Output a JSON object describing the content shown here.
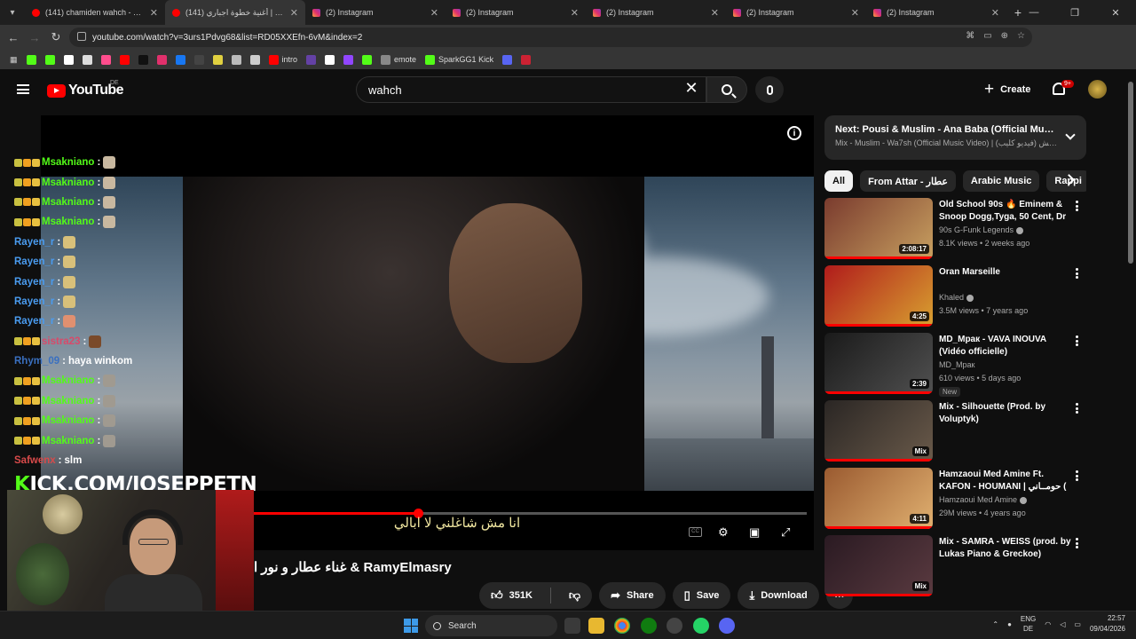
{
  "browser": {
    "tabs": [
      {
        "title": "(141) chamiden wahch - YouTube",
        "favicon": "youtube-icon",
        "active": false
      },
      {
        "title": "(141) أغنية خطوة اجباري | gbary",
        "favicon": "youtube-icon",
        "active": true
      },
      {
        "title": "(2) Instagram",
        "favicon": "instagram-icon",
        "active": false
      },
      {
        "title": "(2) Instagram",
        "favicon": "instagram-icon",
        "active": false
      },
      {
        "title": "(2) Instagram",
        "favicon": "instagram-icon",
        "active": false
      },
      {
        "title": "(2) Instagram",
        "favicon": "instagram-icon",
        "active": false
      },
      {
        "title": "(2) Instagram",
        "favicon": "instagram-icon",
        "active": false
      }
    ],
    "url": "youtube.com/watch?v=3urs1Pdvg68&list=RD05XXEfn-6vM&index=2",
    "bookmarks": [
      {
        "label": "",
        "color": "#53fc18"
      },
      {
        "label": "",
        "color": "#53fc18"
      },
      {
        "label": "",
        "color": "#ffffff"
      },
      {
        "label": "",
        "color": "#dddddd"
      },
      {
        "label": "",
        "color": "#ff4d8d"
      },
      {
        "label": "",
        "color": "#ff0000"
      },
      {
        "label": "",
        "color": "#111111"
      },
      {
        "label": "",
        "color": "#e1306c"
      },
      {
        "label": "",
        "color": "#1877f2"
      },
      {
        "label": "",
        "color": "#444444"
      },
      {
        "label": "",
        "color": "#e0d040"
      },
      {
        "label": "",
        "color": "#bbbbbb"
      },
      {
        "label": "",
        "color": "#cccccc"
      },
      {
        "label": "intro",
        "color": "#ff0000"
      },
      {
        "label": "",
        "color": "#6441a5"
      },
      {
        "label": "",
        "color": "#ffffff"
      },
      {
        "label": "",
        "color": "#9146ff"
      },
      {
        "label": "",
        "color": "#53fc18"
      },
      {
        "label": "emote",
        "color": "#888888"
      },
      {
        "label": "SparkGG1 Kick",
        "color": "#53fc18"
      },
      {
        "label": "",
        "color": "#5865f2"
      },
      {
        "label": "",
        "color": "#cc2233"
      }
    ]
  },
  "youtube": {
    "logo_text": "YouTube",
    "region": "DE",
    "search_value": "wahch",
    "create_label": "Create",
    "notification_badge": "9+",
    "video_title": "غناء عطار و نور ا & RamyElmasry",
    "lyrics": "انا مش شاغلني لا ابالي",
    "progress_fraction": 0.493,
    "actions": {
      "likes": "351K",
      "share": "Share",
      "save": "Save",
      "download": "Download"
    },
    "next": {
      "title": "Next: Pousi & Muslim - Ana Baba (Official Music Vi...",
      "subtitle": "Mix - Muslim - Wa7sh (Official Music Video) | وحش (فيديو كليب)..."
    },
    "chips": [
      "All",
      "From Attar - عطار",
      "Arabic Music",
      "Rappi"
    ],
    "recommendations": [
      {
        "title": "Old School 90s 🔥 Eminem & Snoop Dogg,Tyga, 50 Cent, Dr ...",
        "channel": "90s G-Funk Legends",
        "verified": true,
        "meta": "8.1K views • 2 weeks ago",
        "duration": "2:08:17",
        "new": false,
        "thumb_colors": [
          "#7a3b2e",
          "#c8a060"
        ]
      },
      {
        "title": "Oran Marseille",
        "channel": "Khaled",
        "verified": true,
        "meta": "3.5M views • 7 years ago",
        "duration": "4:25",
        "new": false,
        "thumb_colors": [
          "#b01b1b",
          "#d8a030"
        ]
      },
      {
        "title": "MD_Мрак - VAVA INOUVA (Vidéo officielle)",
        "channel": "MD_Мрак",
        "verified": false,
        "meta": "610 views • 5 days ago",
        "duration": "2:39",
        "new": true,
        "new_label": "New",
        "thumb_colors": [
          "#1a1a1a",
          "#505050"
        ]
      },
      {
        "title": "Mix - Silhouette (Prod. by Voluptyk)",
        "channel": "",
        "verified": false,
        "meta": "",
        "duration": "Mix",
        "new": false,
        "thumb_colors": [
          "#2a2624",
          "#6a5a4a"
        ]
      },
      {
        "title": "Hamzaoui Med Amine Ft. KAFON - HOUMANI | حومــاني ( ...",
        "channel": "Hamzaoui Med Amine",
        "verified": true,
        "meta": "29M views • 4 years ago",
        "duration": "4:11",
        "new": false,
        "thumb_colors": [
          "#9a5a30",
          "#e0b070"
        ]
      },
      {
        "title": "Mix - SAMRA - WEISS (prod. by Lukas Piano & Greckoe)",
        "channel": "",
        "verified": false,
        "meta": "",
        "duration": "Mix",
        "new": false,
        "thumb_colors": [
          "#2a1a22",
          "#5a3a40"
        ]
      }
    ]
  },
  "chat": [
    {
      "user": "Msakniano",
      "color": "#53fc18",
      "msg": "",
      "badges": true,
      "emote": "#c8b8a0"
    },
    {
      "user": "Msakniano",
      "color": "#53fc18",
      "msg": "",
      "badges": true,
      "emote": "#c8b8a0"
    },
    {
      "user": "Msakniano",
      "color": "#53fc18",
      "msg": "",
      "badges": true,
      "emote": "#c8b8a0"
    },
    {
      "user": "Msakniano",
      "color": "#53fc18",
      "msg": "",
      "badges": true,
      "emote": "#c8b8a0"
    },
    {
      "user": "Rayen_r",
      "color": "#4a9cf0",
      "msg": "",
      "badges": false,
      "emote": "#d8c07a"
    },
    {
      "user": "Rayen_r",
      "color": "#4a9cf0",
      "msg": "",
      "badges": false,
      "emote": "#d8c07a"
    },
    {
      "user": "Rayen_r",
      "color": "#4a9cf0",
      "msg": "",
      "badges": false,
      "emote": "#d8c07a"
    },
    {
      "user": "Rayen_r",
      "color": "#4a9cf0",
      "msg": "",
      "badges": false,
      "emote": "#d8c07a"
    },
    {
      "user": "Rayen_r",
      "color": "#4a9cf0",
      "msg": "",
      "badges": false,
      "emote": "#e09070"
    },
    {
      "user": "sistra23",
      "color": "#d84a6a",
      "msg": "",
      "badges": true,
      "emote": "#7a4a2a"
    },
    {
      "user": "Rhym_09",
      "color": "#3a70c0",
      "msg": "haya winkom",
      "badges": false,
      "emote": ""
    },
    {
      "user": "Msakniano",
      "color": "#53fc18",
      "msg": "",
      "badges": true,
      "emote": "#a09a90"
    },
    {
      "user": "Msakniano",
      "color": "#53fc18",
      "msg": "",
      "badges": true,
      "emote": "#a09a90"
    },
    {
      "user": "Msakniano",
      "color": "#53fc18",
      "msg": "",
      "badges": true,
      "emote": "#a09a90"
    },
    {
      "user": "Msakniano",
      "color": "#53fc18",
      "msg": "",
      "badges": true,
      "emote": "#a09a90"
    },
    {
      "user": "Safwenx",
      "color": "#d84a4a",
      "msg": "slm",
      "badges": false,
      "emote": ""
    }
  ],
  "stream": {
    "kick_prefix": "K",
    "kick_rest": "ICK.COM/JOSEPPETN"
  },
  "taskbar": {
    "search_label": "Search",
    "lang_line1": "ENG",
    "lang_line2": "DE",
    "time": "22:57",
    "date": "09/04/2026"
  }
}
